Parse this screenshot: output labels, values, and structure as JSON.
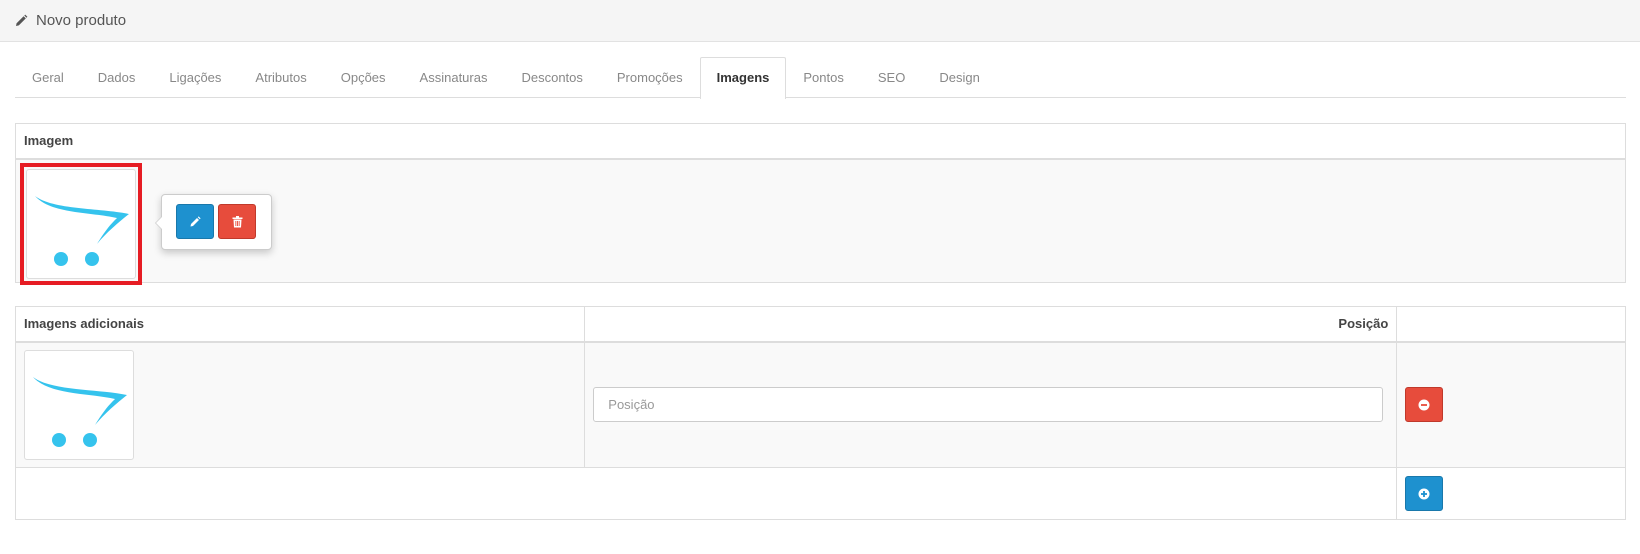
{
  "header": {
    "title": "Novo produto",
    "icon": "pencil-icon"
  },
  "tabs": [
    {
      "label": "Geral"
    },
    {
      "label": "Dados"
    },
    {
      "label": "Ligações"
    },
    {
      "label": "Atributos"
    },
    {
      "label": "Opções"
    },
    {
      "label": "Assinaturas"
    },
    {
      "label": "Descontos"
    },
    {
      "label": "Promoções"
    },
    {
      "label": "Imagens",
      "active": true
    },
    {
      "label": "Pontos"
    },
    {
      "label": "SEO"
    },
    {
      "label": "Design"
    }
  ],
  "image_section": {
    "header": "Imagem",
    "edit_icon": "pencil-icon",
    "delete_icon": "trash-icon"
  },
  "additional_images": {
    "headers": {
      "images": "Imagens adicionais",
      "position": "Posição",
      "actions": ""
    },
    "rows": [
      {
        "position_value": "",
        "position_placeholder": "Posição"
      }
    ],
    "remove_icon": "minus-circle-icon",
    "add_icon": "plus-circle-icon"
  },
  "colors": {
    "primary": "#1e91cf",
    "danger": "#e74c3c",
    "highlight": "#e61c23",
    "logo": "#35c3ed"
  }
}
